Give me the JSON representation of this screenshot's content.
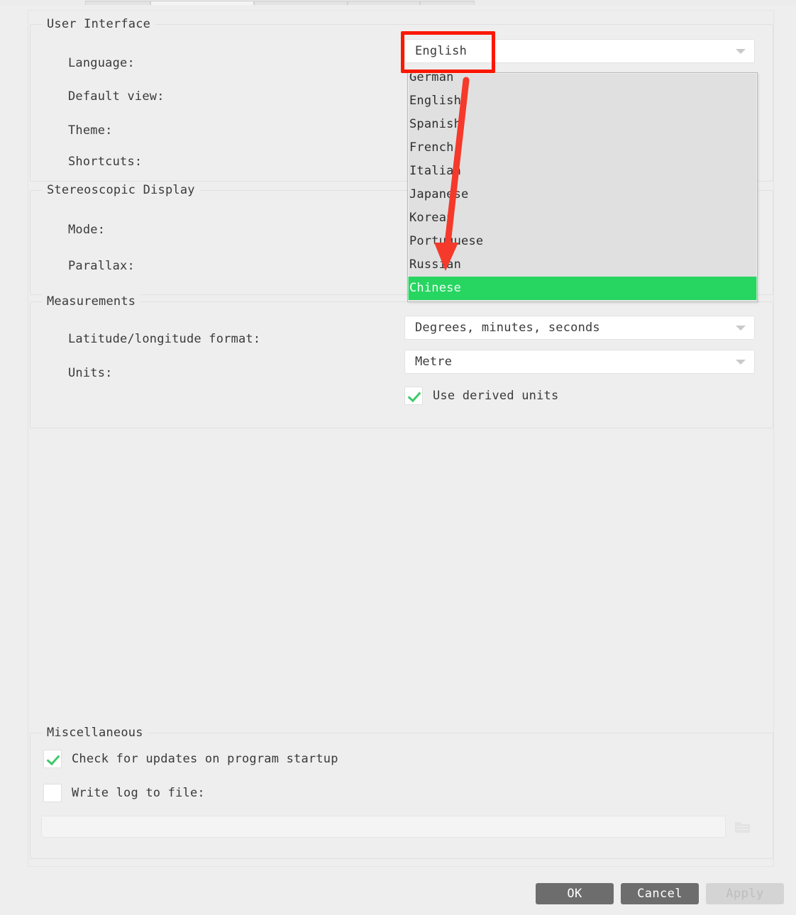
{
  "dialog": {
    "groups": {
      "user_interface": {
        "title": "User Interface",
        "rows": [
          {
            "label": "Language:"
          },
          {
            "label": "Default view:"
          },
          {
            "label": "Theme:"
          },
          {
            "label": "Shortcuts:"
          }
        ]
      },
      "stereoscopic_display": {
        "title": "Stereoscopic Display",
        "rows": [
          {
            "label": "Mode:"
          },
          {
            "label": "Parallax:"
          }
        ]
      },
      "measurements": {
        "title": "Measurements",
        "rows": [
          {
            "label": "Latitude/longitude format:"
          },
          {
            "label": "Units:"
          }
        ],
        "latlon_value": "Degrees, minutes, seconds",
        "units_value": "Metre",
        "use_derived_units_label": "Use derived units",
        "use_derived_units_checked": true
      },
      "miscellaneous": {
        "title": "Miscellaneous",
        "check_updates_label": "Check for updates on program startup",
        "check_updates_checked": true,
        "write_log_label": "Write log to file:",
        "write_log_checked": false,
        "log_path_value": ""
      }
    },
    "language_combo": {
      "value": "English",
      "options": [
        "German",
        "English",
        "Spanish",
        "French",
        "Italian",
        "Japanese",
        "Korean",
        "Portuguese",
        "Russian",
        "Chinese"
      ],
      "highlighted": "Chinese",
      "expanded": true
    },
    "buttons": {
      "ok": "OK",
      "cancel": "Cancel",
      "apply": "Apply",
      "apply_disabled": true
    },
    "icons": {
      "combo_arrow": "chevron-down-icon",
      "folder": "folder-icon",
      "check": "check-icon"
    },
    "colors": {
      "highlight_green": "#27d561",
      "annotation_red": "#fb1800",
      "dialog_bg": "#eeeeee",
      "dropdown_bg": "#e0e0e0",
      "button_primary": "#6d6d6d",
      "button_disabled": "#d4d4d4"
    }
  }
}
